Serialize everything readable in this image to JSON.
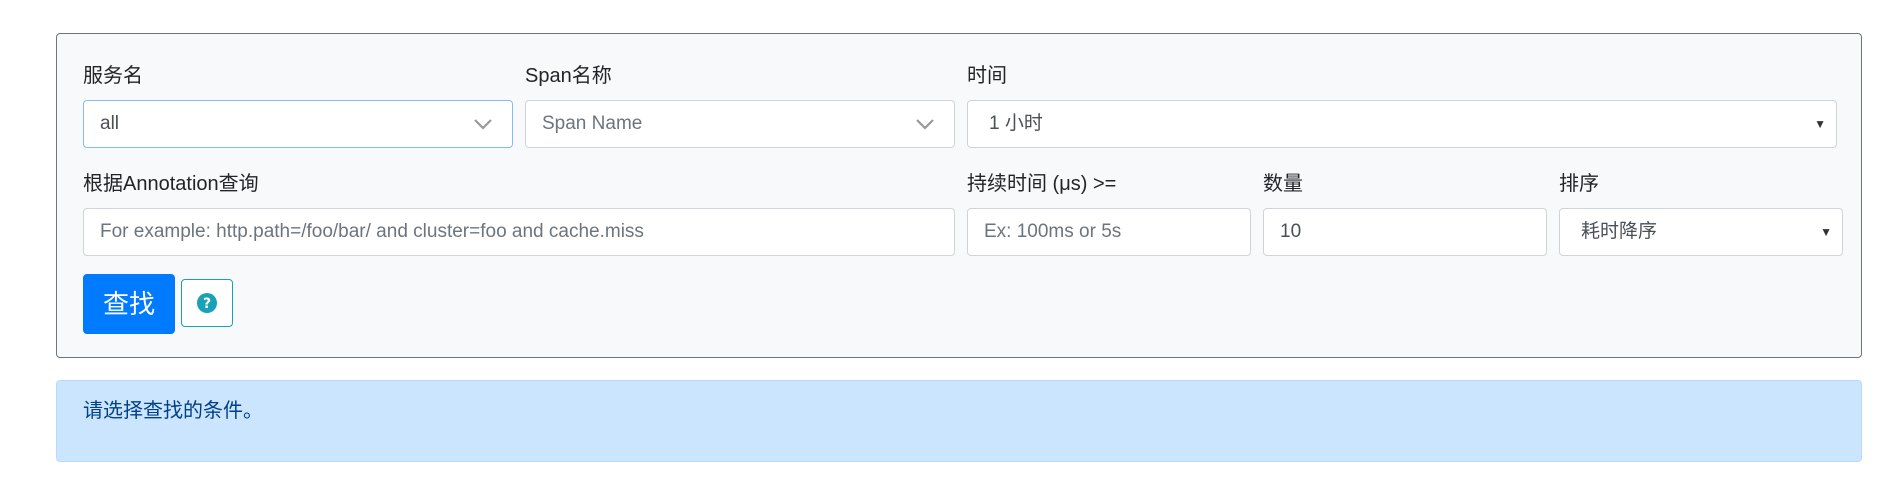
{
  "search_form": {
    "service_name": {
      "label": "服务名",
      "value": "all"
    },
    "span_name": {
      "label": "Span名称",
      "placeholder": "Span Name"
    },
    "time": {
      "label": "时间",
      "value": "1 小时"
    },
    "annotation_query": {
      "label": "根据Annotation查询",
      "placeholder": "For example: http.path=/foo/bar/ and cluster=foo and cache.miss"
    },
    "min_duration": {
      "label": "持续时间 (μs) >=",
      "placeholder": "Ex: 100ms or 5s"
    },
    "limit": {
      "label": "数量",
      "value": "10"
    },
    "sort": {
      "label": "排序",
      "value": "耗时降序"
    },
    "search_button_label": "查找",
    "help_icon": "question-circle-icon"
  },
  "info_alert": {
    "text": "请选择查找的条件。"
  },
  "colors": {
    "primary": "#007bff",
    "info_bg": "#cce5ff",
    "info_text": "#004085",
    "help_border": "#17a2b8"
  }
}
